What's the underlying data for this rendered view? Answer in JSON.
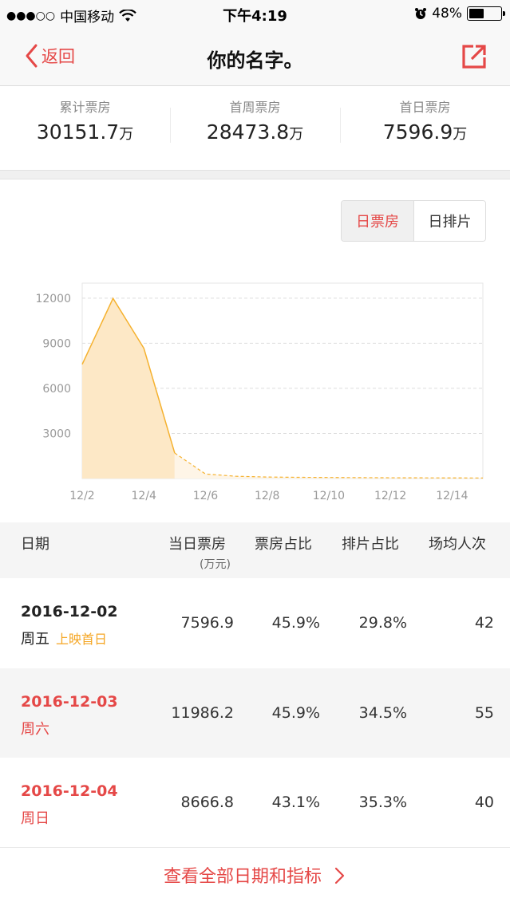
{
  "status_bar": {
    "signal": "●●●○○",
    "carrier": "中国移动",
    "time": "下午4:19",
    "battery": "48%",
    "battery_level": 0.48
  },
  "nav": {
    "back_label": "返回",
    "title": "你的名字。"
  },
  "summary": [
    {
      "label": "累计票房",
      "value": "30151.7",
      "unit": "万"
    },
    {
      "label": "首周票房",
      "value": "28473.8",
      "unit": "万"
    },
    {
      "label": "首日票房",
      "value": "7596.9",
      "unit": "万"
    }
  ],
  "toggle": {
    "active": "日票房",
    "inactive": "日排片"
  },
  "chart_data": {
    "type": "area",
    "x": [
      "12/2",
      "12/3",
      "12/4",
      "12/5",
      "12/6",
      "12/7",
      "12/8",
      "12/9",
      "12/10",
      "12/11",
      "12/12",
      "12/13",
      "12/14",
      "12/15"
    ],
    "values": [
      7596.9,
      11986.2,
      8666.8,
      1700,
      300,
      150,
      100,
      80,
      70,
      60,
      50,
      45,
      40,
      35
    ],
    "solid_through": "12/5",
    "xticks": [
      "12/2",
      "12/4",
      "12/6",
      "12/8",
      "12/10",
      "12/12",
      "12/14"
    ],
    "yticks": [
      3000,
      6000,
      9000,
      12000
    ],
    "ylim": [
      0,
      13000
    ],
    "grid": true,
    "color": "#f5b12e",
    "fill": "#fde8c6"
  },
  "table": {
    "headers": {
      "date": "日期",
      "daily_box": "当日票房",
      "daily_box_unit": "(万元)",
      "box_share": "票房占比",
      "screen_share": "排片占比",
      "avg_attendance": "场均人次"
    },
    "rows": [
      {
        "date": "2016-12-02",
        "weekday": "周五",
        "tag": "上映首日",
        "box": "7596.9",
        "box_share": "45.9%",
        "screen_share": "29.8%",
        "attendance": "42",
        "weekend": false
      },
      {
        "date": "2016-12-03",
        "weekday": "周六",
        "tag": "",
        "box": "11986.2",
        "box_share": "45.9%",
        "screen_share": "34.5%",
        "attendance": "55",
        "weekend": true
      },
      {
        "date": "2016-12-04",
        "weekday": "周日",
        "tag": "",
        "box": "8666.8",
        "box_share": "43.1%",
        "screen_share": "35.3%",
        "attendance": "40",
        "weekend": true
      }
    ]
  },
  "footer": {
    "link_label": "查看全部日期和指标",
    "chevron": "chevron-right-icon"
  },
  "colors": {
    "accent_red": "#e54847",
    "tag_orange": "#f5a623",
    "weekend_red": "#e54847"
  }
}
